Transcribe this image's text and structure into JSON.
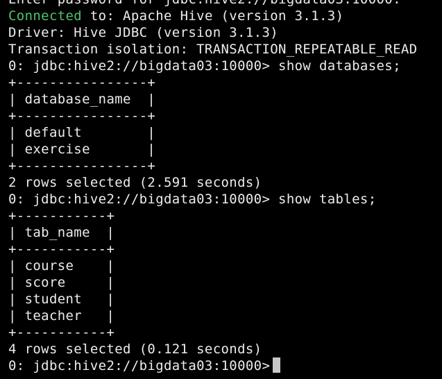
{
  "terminal": {
    "connected_word": "Connected",
    "lines": [
      "Enter password for jdbc:hive2://bigdata03:10000:",
      " to: Apache Hive (version 3.1.3)",
      "Driver: Hive JDBC (version 3.1.3)",
      "Transaction isolation: TRANSACTION_REPEATABLE_READ",
      "0: jdbc:hive2://bigdata03:10000> show databases;",
      "+----------------+",
      "| database_name  |",
      "+----------------+",
      "| default        |",
      "| exercise       |",
      "+----------------+",
      "2 rows selected (2.591 seconds)",
      "0: jdbc:hive2://bigdata03:10000> show tables;",
      "+-----------+",
      "| tab_name  |",
      "+-----------+",
      "| course    |",
      "| score     |",
      "| student   |",
      "| teacher   |",
      "+-----------+",
      "4 rows selected (0.121 seconds)",
      "0: jdbc:hive2://bigdata03:10000>"
    ]
  }
}
